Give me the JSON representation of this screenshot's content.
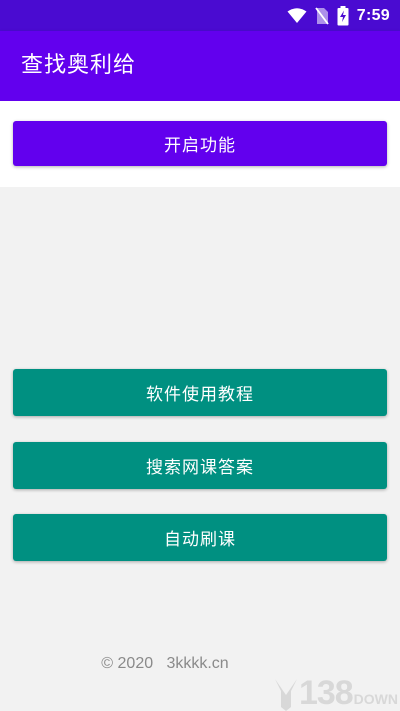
{
  "status_bar": {
    "time": "7:59",
    "icons": [
      "wifi-icon",
      "no-sim-icon",
      "battery-charging-icon"
    ]
  },
  "app_bar": {
    "title": "查找奥利给"
  },
  "buttons": {
    "enable_feature": "开启功能",
    "tutorial": "软件使用教程",
    "search_answers": "搜索网课答案",
    "auto_study": "自动刷课"
  },
  "footer": {
    "copyright": "© 2020",
    "site": "3kkkk.cn"
  },
  "watermark": {
    "number": "138",
    "suffix": "DOWN"
  },
  "colors": {
    "status_bar": "#4a0bd1",
    "primary": "#6200ee",
    "teal": "#009081",
    "background": "#f2f2f2"
  }
}
